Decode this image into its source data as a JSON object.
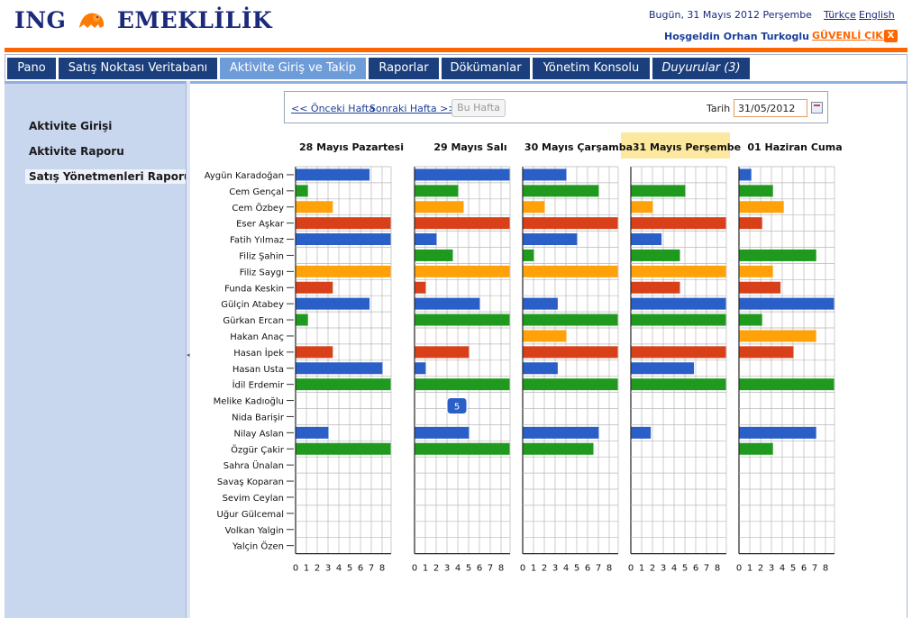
{
  "header": {
    "logo_text": "ING",
    "logo_text2": "EMEKLİLİK",
    "date_text": "Bugün,  31 Mayıs 2012 Perşembe",
    "lang_tr": "Türkçe",
    "lang_en": "English",
    "welcome": "Hoşgeldin Orhan Turkoglu",
    "logout": "GÜVENLİ ÇIKIŞ",
    "logout_icon": "X"
  },
  "colors": {
    "orange": "#ff6600",
    "navy": "#1b3f7d",
    "active_tab": "#6d9cd9",
    "blue": "#2a5fc8",
    "green": "#1f9a1f",
    "amber": "#ffa20a",
    "red": "#d8401a"
  },
  "tabs": [
    {
      "label": "Pano"
    },
    {
      "label": "Satış Noktası Veritabanı"
    },
    {
      "label": "Aktivite Giriş ve Takip"
    },
    {
      "label": "Raporlar"
    },
    {
      "label": "Dökümanlar"
    },
    {
      "label": "Yönetim Konsolu"
    },
    {
      "label": "Duyurular (3)"
    }
  ],
  "sidebar": {
    "items": [
      {
        "label": "Aktivite Girişi"
      },
      {
        "label": "Aktivite Raporu"
      },
      {
        "label": "Satış Yönetmenleri Raporu"
      }
    ]
  },
  "weekbar": {
    "prev": "<< Önceki Hafta",
    "next": "Sonraki Hafta >>",
    "this_week": "Bu Hafta",
    "date_label": "Tarih",
    "date_value": "31/05/2012"
  },
  "chart_data": {
    "type": "bar",
    "names": [
      "Aygün Karadoğan",
      "Cem Gençal",
      "Cem Özbey",
      "Eser Aşkar",
      "Fatih Yılmaz",
      "Filiz Şahin",
      "Filiz Saygı",
      "Funda Keskin",
      "Gülçin Atabey",
      "Gürkan Ercan",
      "Hakan Anaç",
      "Hasan İpek",
      "Hasan Usta",
      "İdil Erdemir",
      "Melike Kadıoğlu",
      "Nida Barişir",
      "Nilay Aslan",
      "Özgür Çakir",
      "Sahra Ünalan",
      "Savaş Koparan",
      "Sevim Ceylan",
      "Uğur Gülcemal",
      "Volkan Yalgin",
      "Yalçin Özen"
    ],
    "color_cycle": [
      "blue",
      "green",
      "amber",
      "red"
    ],
    "xticks": [
      "0",
      "1",
      "2",
      "3",
      "4",
      "5",
      "6",
      "7",
      "8"
    ],
    "xlim": [
      0,
      8
    ],
    "highlight_day": 3,
    "tooltip": {
      "day": 1,
      "row": 15,
      "value": "5"
    },
    "days": [
      {
        "label": "28 Mayıs Pazartesi",
        "values": [
          6.8,
          1.1,
          3.4,
          9,
          9,
          0,
          9,
          3.4,
          6.8,
          1.1,
          0,
          3.4,
          8,
          9,
          0,
          0,
          3,
          9,
          0,
          0,
          0,
          0,
          0,
          0
        ]
      },
      {
        "label": "29 Mayıs Salı",
        "values": [
          9,
          4,
          4.5,
          9,
          2,
          3.5,
          9,
          1,
          6,
          9,
          0,
          5,
          1,
          9,
          0,
          0,
          5,
          9,
          0,
          0,
          0,
          0,
          0,
          0
        ]
      },
      {
        "label": "30 Mayıs Çarşamba",
        "values": [
          4,
          7,
          2,
          9,
          5,
          1,
          9,
          0,
          3.2,
          9,
          4,
          9,
          3.2,
          9,
          0,
          0,
          7,
          6.5,
          0,
          0,
          0,
          0,
          0,
          0
        ]
      },
      {
        "label": "31 Mayıs Perşembe",
        "values": [
          0,
          5,
          2,
          9,
          2.8,
          4.5,
          9,
          4.5,
          9,
          9,
          0,
          9,
          5.8,
          9,
          0,
          0,
          1.8,
          0,
          0,
          0,
          0,
          0,
          0,
          0
        ]
      },
      {
        "label": "01 Haziran Cuma",
        "values": [
          1.1,
          3.1,
          4.1,
          2.1,
          0,
          7.1,
          3.1,
          3.8,
          9,
          2.1,
          7.1,
          5,
          0,
          9,
          0,
          0,
          7.1,
          3.1,
          0,
          0,
          0,
          0,
          0,
          0
        ]
      }
    ]
  }
}
